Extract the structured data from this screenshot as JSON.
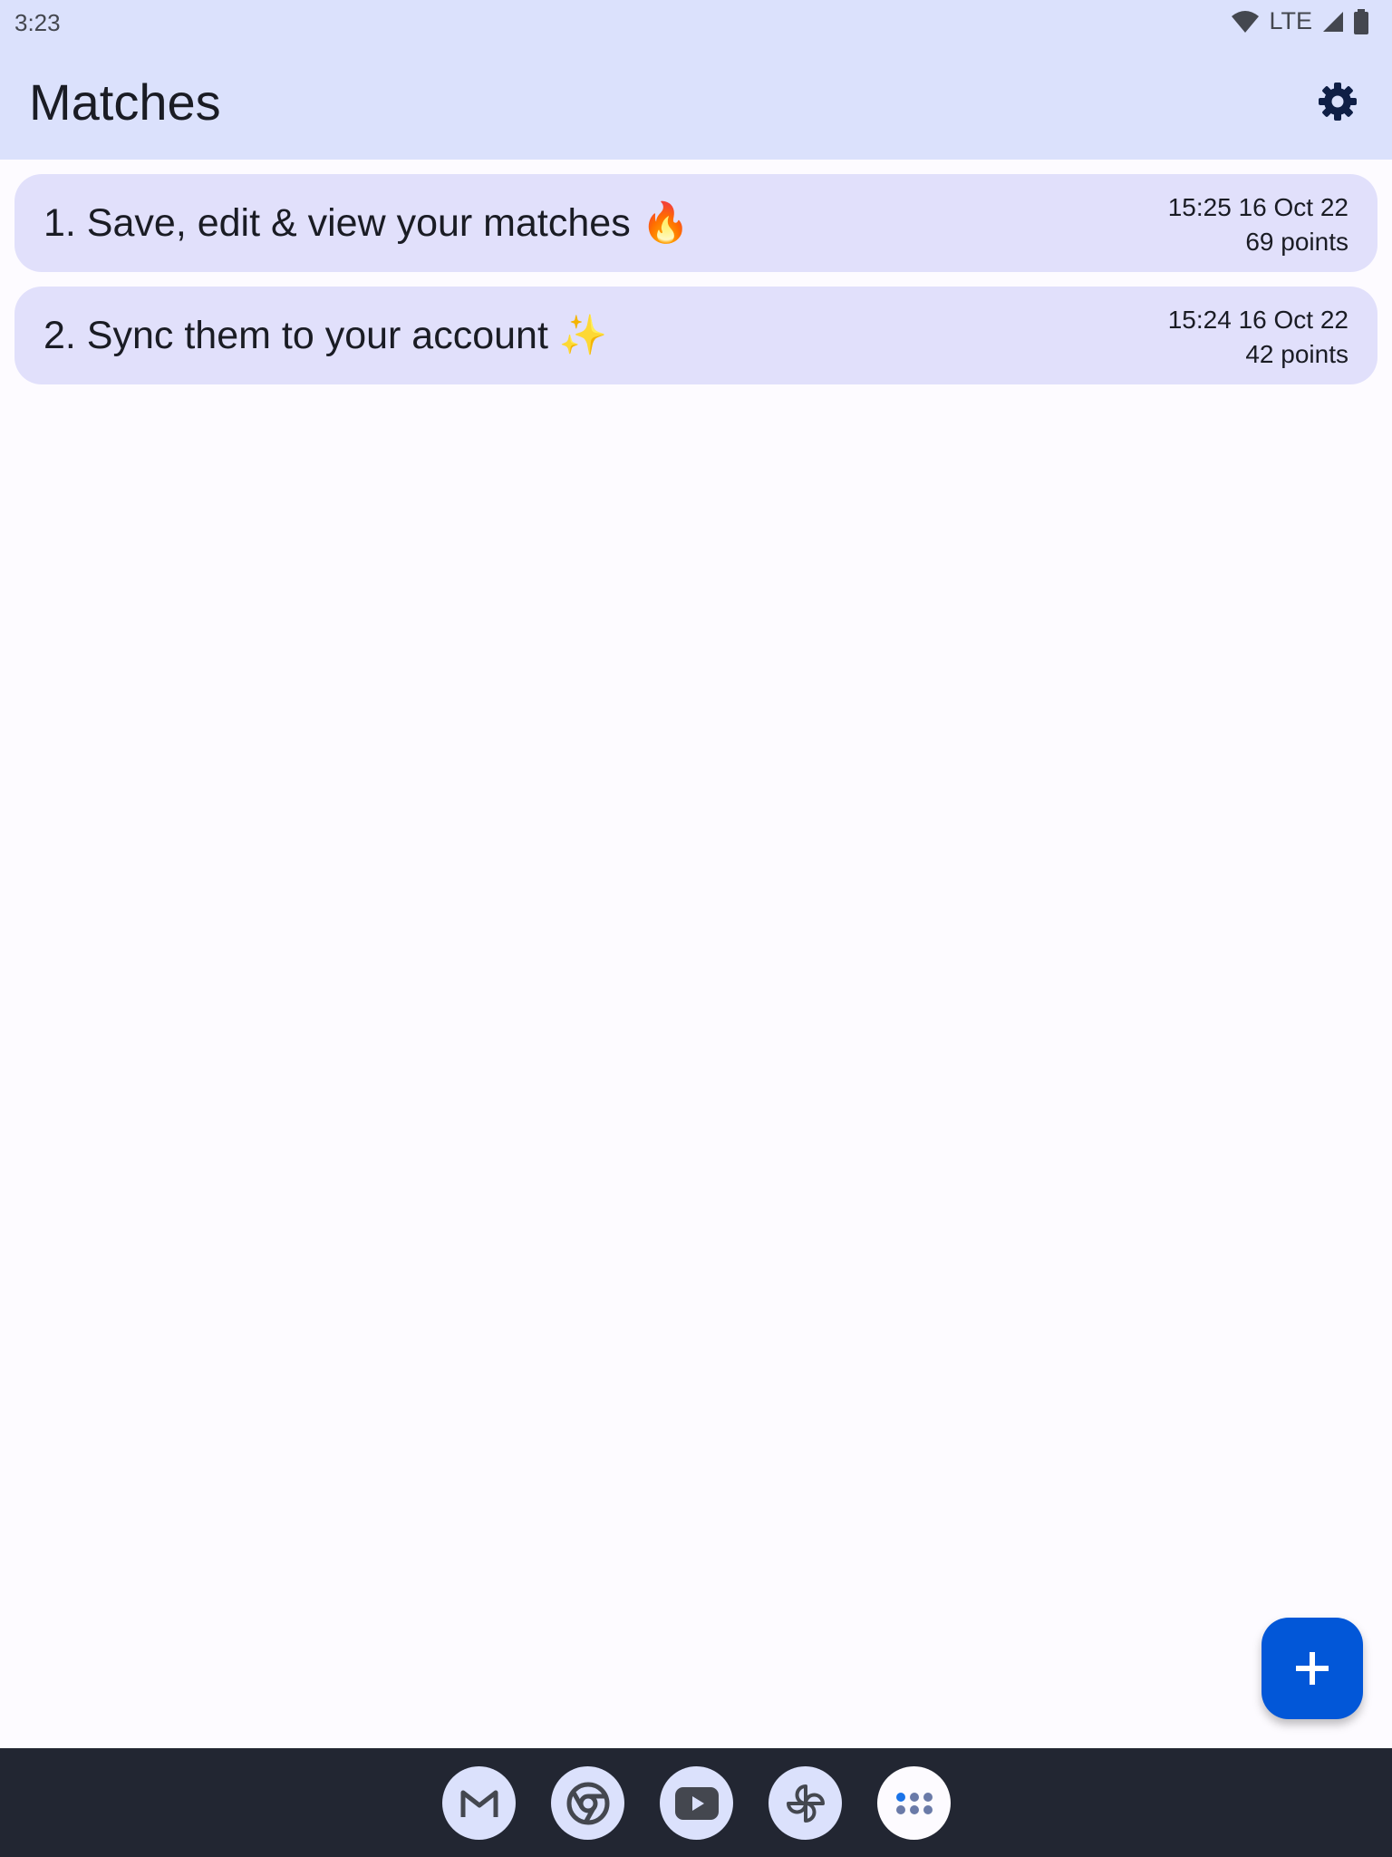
{
  "status_bar": {
    "time": "3:23",
    "network_label": "LTE",
    "icons": [
      "wifi-icon",
      "signal-icon",
      "battery-icon"
    ]
  },
  "app_bar": {
    "title": "Matches",
    "settings_icon": "gear-icon"
  },
  "matches": [
    {
      "title": "1. Save, edit & view your matches 🔥",
      "datetime": "15:25 16 Oct 22",
      "points": "69 points"
    },
    {
      "title": "2. Sync them to your account ✨",
      "datetime": "15:24 16 Oct 22",
      "points": "42 points"
    }
  ],
  "fab": {
    "icon": "plus-icon"
  },
  "dock": {
    "apps": [
      "gmail-icon",
      "chrome-icon",
      "youtube-icon",
      "photos-icon",
      "app-drawer-icon"
    ]
  },
  "colors": {
    "app_bar_bg": "#dbe1fc",
    "card_bg": "#e1e0fb",
    "fab_bg": "#0257d8",
    "nav_bar_bg": "#222632"
  }
}
